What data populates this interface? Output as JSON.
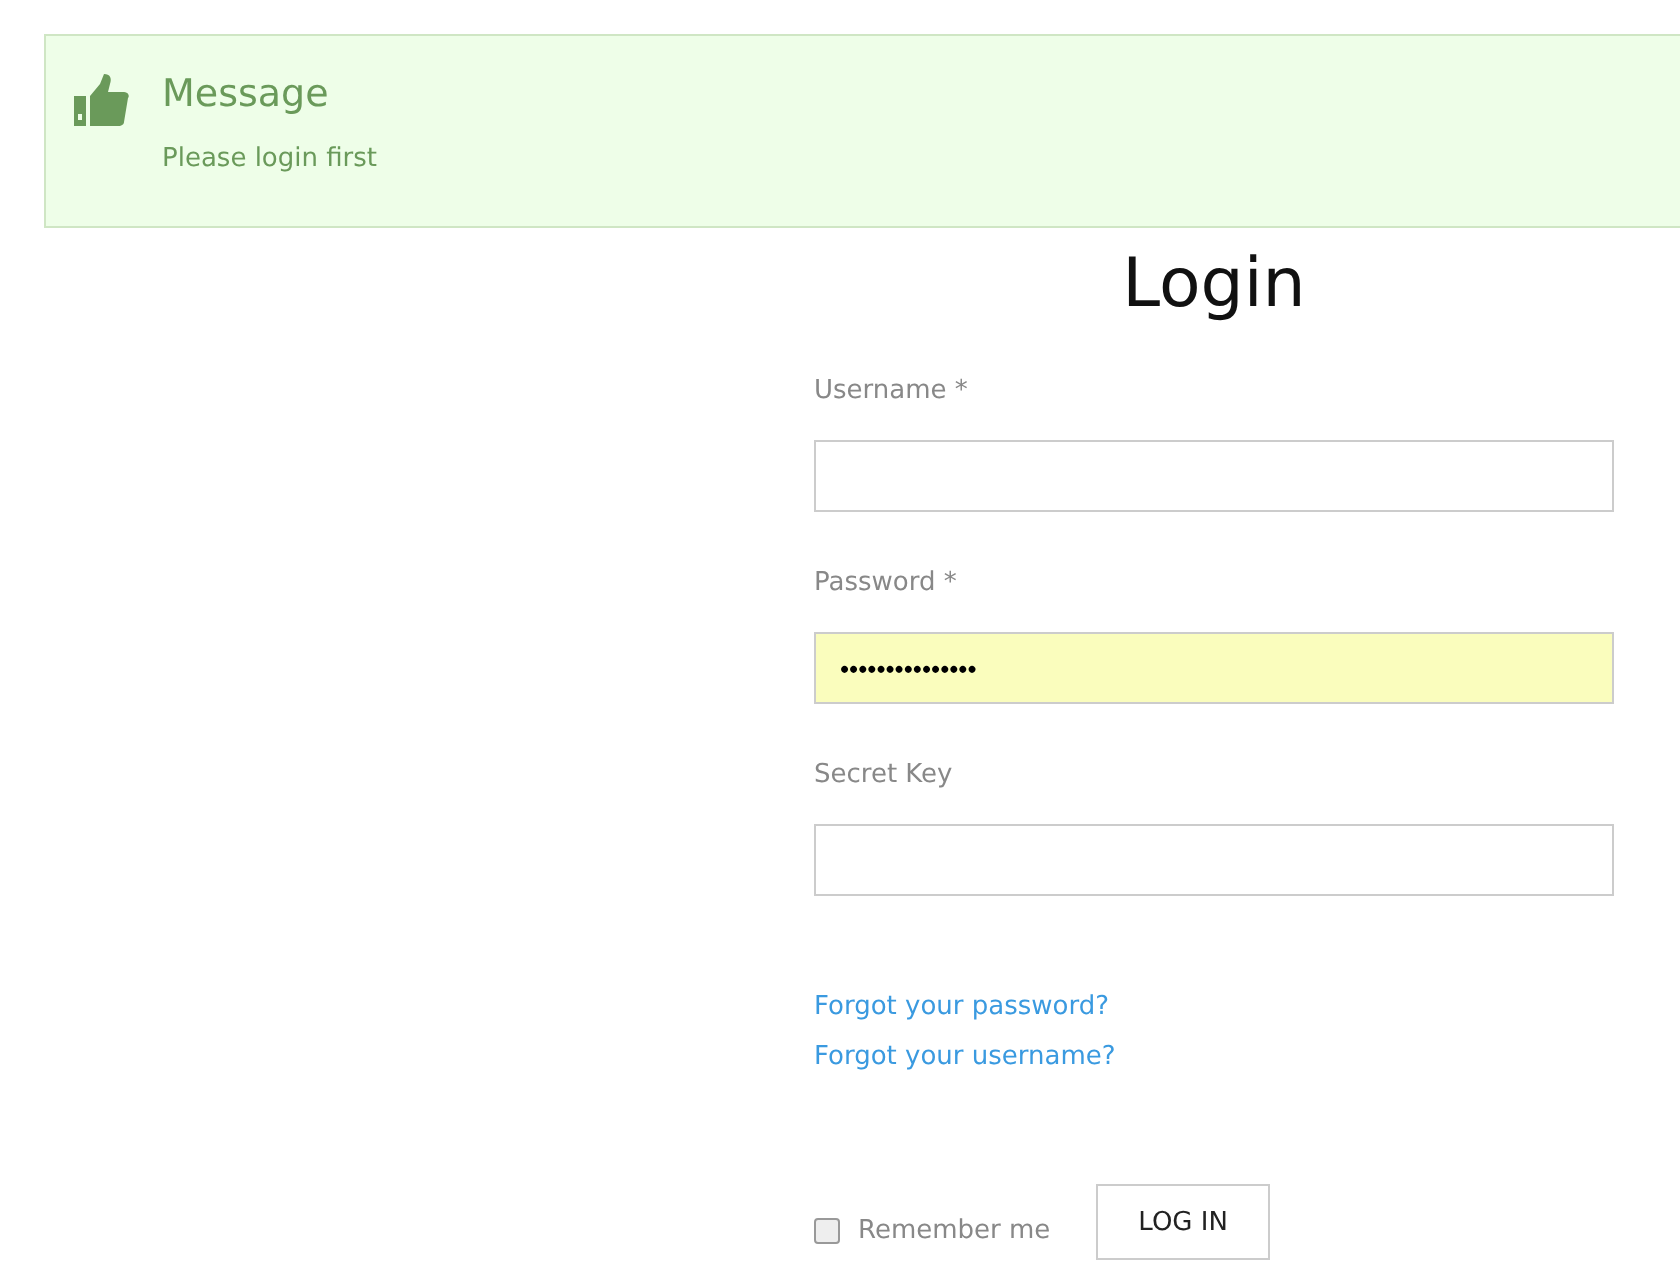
{
  "message": {
    "title": "Message",
    "text": "Please login first"
  },
  "login": {
    "title": "Login",
    "fields": [
      {
        "label": "Username *",
        "autofilled": false
      },
      {
        "label": "Password *",
        "value": "•••••••••••••••",
        "autofilled": true
      },
      {
        "label": "Secret Key",
        "autofilled": false
      }
    ],
    "links": [
      "Forgot your password?",
      "Forgot your username?"
    ],
    "remember": {
      "label": "Remember me",
      "checked": false
    },
    "button": "LOG IN"
  }
}
